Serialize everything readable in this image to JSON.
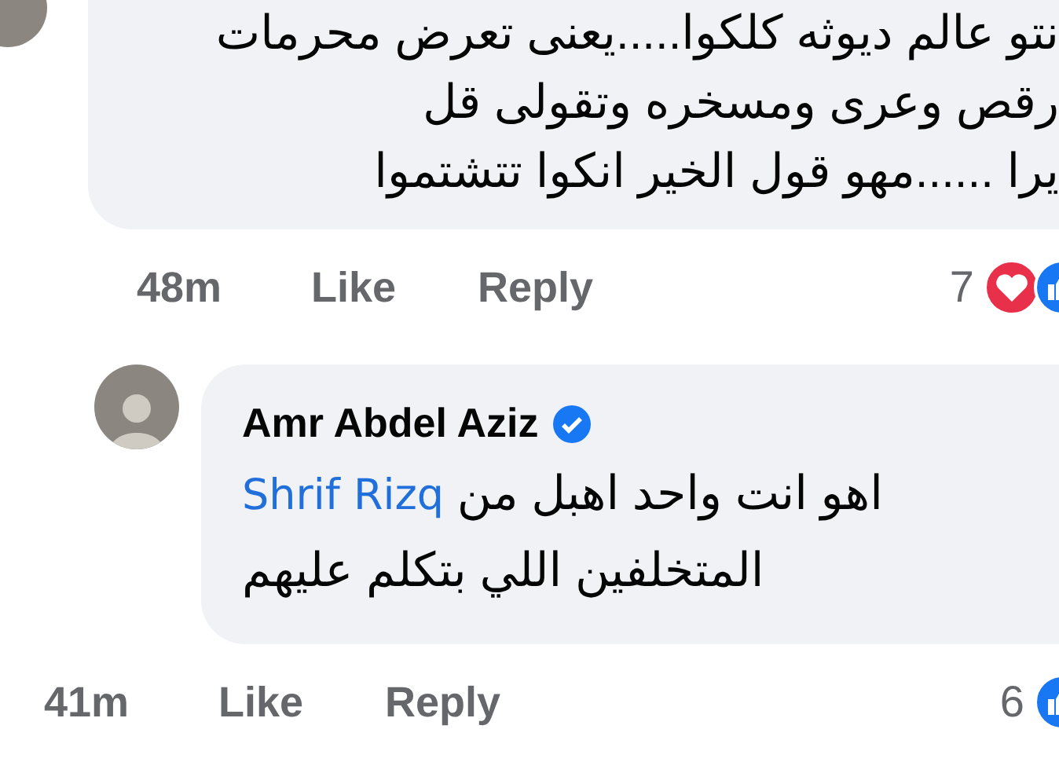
{
  "comments": [
    {
      "lines": [
        "نتو عالم ديوثه كلكوا.....يعنى تعرض محرمات",
        "رقص وعرى ومسخره وتقولى قل",
        "يرا ......مهو قول الخير انكوا تتشتموا"
      ],
      "time": "48m",
      "like": "Like",
      "reply": "Reply",
      "reaction_count": "7",
      "reactions": [
        {
          "kind": "love"
        },
        {
          "kind": "like"
        }
      ]
    },
    {
      "author": "Amr Abdel Aziz",
      "verified": true,
      "mention": "Shrif Rizq",
      "lines": [
        "اهو انت واحد اهبل من",
        "المتخلفين اللي بتكلم عليهم"
      ],
      "time": "41m",
      "like": "Like",
      "reply": "Reply",
      "reaction_count": "6",
      "reactions": [
        {
          "kind": "like"
        }
      ]
    }
  ]
}
